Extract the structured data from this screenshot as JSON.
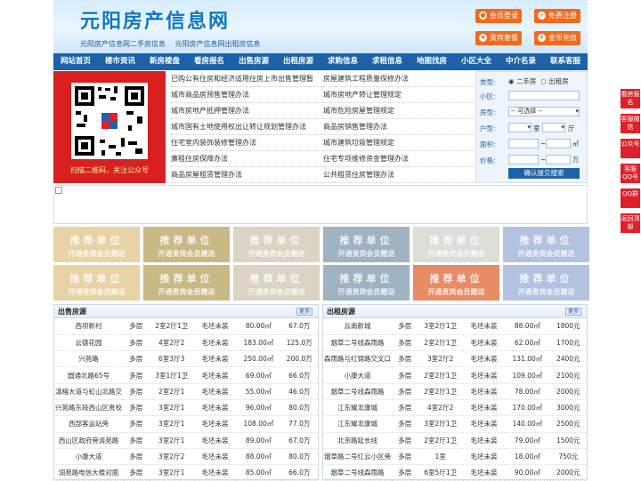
{
  "site": {
    "logo": "元阳房产信息网",
    "sublinks": [
      "元阳房产信息网二手房信息",
      "元阳房产信息网出租房信息"
    ],
    "buttons": {
      "login": "会员登录",
      "register": "免费注册",
      "package": "贵宾套餐",
      "recharge": "金币充值"
    }
  },
  "nav": [
    "网站首页",
    "楼市资讯",
    "新房楼盘",
    "看房报名",
    "出售房源",
    "出租房源",
    "求购信息",
    "求租信息",
    "地图找房",
    "小区大全",
    "中介名录",
    "联系客服"
  ],
  "qr_caption": "扫描二维码，关注公众号",
  "news_left": [
    "已购公有住房和经济适用住房上市出售管理暂",
    "城市商品房预售管理办法",
    "城市房地产抵押管理办法",
    "城市国有土地使用权出让转让规划管理办法",
    "住宅室内装饰装修管理办法",
    "廉租住房保障办法",
    "商品房屋租赁管理办法"
  ],
  "news_right": [
    "房屋建筑工程质量保修办法",
    "城市房地产转让管理规定",
    "城市危险房屋管理规定",
    "商品房销售管理办法",
    "城市建筑垃圾管理规定",
    "住宅专项维修资金管理办法",
    "公共租赁住房管理办法"
  ],
  "search": {
    "type_label": "类型:",
    "type_options": [
      "二手房",
      "出租房"
    ],
    "community_label": "小区:",
    "room_label": "房型:",
    "room_select": "-- 可选择 --",
    "layout_label": "户型:",
    "room_unit": "室",
    "hall_unit": "厅",
    "area_label": "面积:",
    "area_unit": "㎡",
    "price_label": "价格:",
    "price_unit": "万",
    "submit": "确认提交搜索"
  },
  "recommend": {
    "title": "推荐单位",
    "subtitle": "开通贵宾会员赠送"
  },
  "recommend_colors": [
    "#e8d3a6",
    "#c9b985",
    "#dbd3c3",
    "#9fb3c2",
    "#dcdfd8",
    "#b3c2df",
    "#e8d3a6",
    "#c9b985",
    "#dbd3c3",
    "#9fb3c2",
    "#e98b65",
    "#b3c2df"
  ],
  "sale_panel": {
    "title": "出售房源",
    "more": "更多",
    "rows": [
      [
        "西坝新村",
        "多层",
        "2室2厅1卫",
        "毛坯未装",
        "80.00㎡",
        "67.0万"
      ],
      [
        "云德花园",
        "多层",
        "4室2厅2",
        "毛坯未装",
        "183.00㎡",
        "125.0万"
      ],
      [
        "兴苑路",
        "多层",
        "6室3厅3",
        "毛坯未装",
        "250.00㎡",
        "200.0万"
      ],
      [
        "圆通北路65号",
        "多层",
        "3室1厅1卫",
        "毛坯未装",
        "69.00㎡",
        "66.0万"
      ],
      [
        "滇榕大道与虹山北路交",
        "多层",
        "2室2厅1",
        "毛坯未装",
        "55.00㎡",
        "46.0万"
      ],
      [
        "兴苑路东段西山区贵校",
        "多层",
        "3室2厅1",
        "毛坯未装",
        "96.00㎡",
        "80.0万"
      ],
      [
        "西部客运站旁",
        "多层",
        "3室2厅1",
        "毛坯未装",
        "108.00㎡",
        "77.0万"
      ],
      [
        "西山区政府旁清苑路",
        "多层",
        "3室2厅1",
        "毛坯未装",
        "89.00㎡",
        "67.0万"
      ],
      [
        "小康大道",
        "多层",
        "3室2厅2",
        "毛坯未装",
        "88.00㎡",
        "80.0万"
      ],
      [
        "润苑路电信大楼对面",
        "多层",
        "3室2厅1",
        "毛坯未装",
        "85.00㎡",
        "66.0万"
      ]
    ]
  },
  "rent_panel": {
    "title": "出租房源",
    "more": "更多",
    "rows": [
      [
        "云南新城",
        "多层",
        "3室2厅1卫",
        "毛坯未装",
        "88.00㎡",
        "1800元"
      ],
      [
        "烟草二号线森雨路",
        "多层",
        "2室2厅1卫",
        "毛坯未装",
        "62.00㎡",
        "1700元"
      ],
      [
        "森雨路与红锦路交叉口",
        "多层",
        "3室2厅2",
        "毛坯未装",
        "131.00㎡",
        "2400元"
      ],
      [
        "小康大道",
        "多层",
        "2室2厅1卫",
        "毛坯未装",
        "109.00㎡",
        "2100元"
      ],
      [
        "烟草二号线森雨路",
        "多层",
        "2室2厅1卫",
        "毛坯未装",
        "78.00㎡",
        "2000元"
      ],
      [
        "江东耀龙康城",
        "多层",
        "4室2厅2",
        "毛坯未装",
        "170.00㎡",
        "3000元"
      ],
      [
        "江东耀龙康城",
        "多层",
        "3室2厅1卫",
        "毛坯未装",
        "140.00㎡",
        "2500元"
      ],
      [
        "北京路延长线",
        "多层",
        "2室2厅1卫",
        "毛坯未装",
        "79.00㎡",
        "1500元"
      ],
      [
        "烟草路二号红云小区旁",
        "多层",
        "1室",
        "毛坯未装",
        "18.00㎡",
        "750元"
      ],
      [
        "烟草二号线森雨路",
        "多层",
        "6室5厅1卫",
        "毛坯未装",
        "90.00㎡",
        "2000元"
      ]
    ]
  },
  "side_buttons": [
    "看房报名",
    "客服微信",
    "公众号",
    "客服QQ号",
    "QQ群",
    "返回顶部"
  ]
}
